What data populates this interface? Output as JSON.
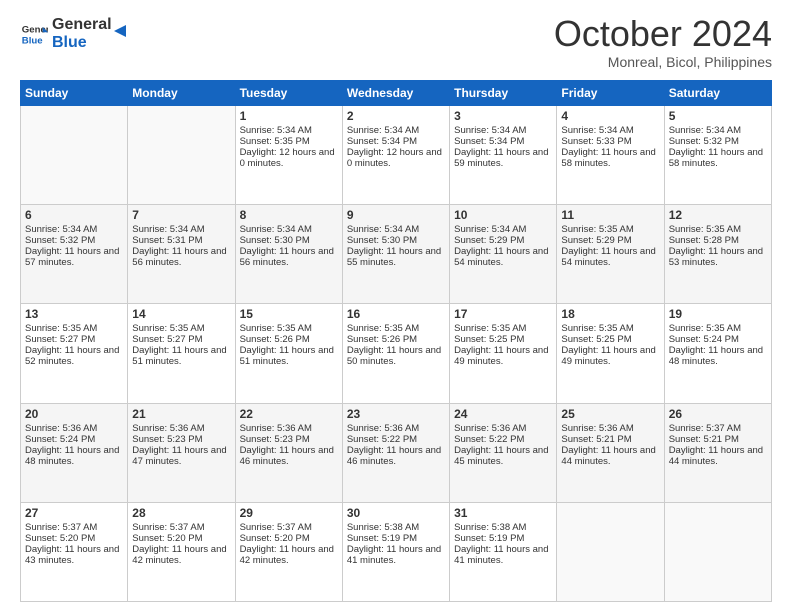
{
  "header": {
    "logo_general": "General",
    "logo_blue": "Blue",
    "month_title": "October 2024",
    "location": "Monreal, Bicol, Philippines"
  },
  "days_of_week": [
    "Sunday",
    "Monday",
    "Tuesday",
    "Wednesday",
    "Thursday",
    "Friday",
    "Saturday"
  ],
  "weeks": [
    [
      {
        "day": "",
        "info": ""
      },
      {
        "day": "",
        "info": ""
      },
      {
        "day": "1",
        "sunrise": "Sunrise: 5:34 AM",
        "sunset": "Sunset: 5:35 PM",
        "daylight": "Daylight: 12 hours and 0 minutes."
      },
      {
        "day": "2",
        "sunrise": "Sunrise: 5:34 AM",
        "sunset": "Sunset: 5:34 PM",
        "daylight": "Daylight: 12 hours and 0 minutes."
      },
      {
        "day": "3",
        "sunrise": "Sunrise: 5:34 AM",
        "sunset": "Sunset: 5:34 PM",
        "daylight": "Daylight: 11 hours and 59 minutes."
      },
      {
        "day": "4",
        "sunrise": "Sunrise: 5:34 AM",
        "sunset": "Sunset: 5:33 PM",
        "daylight": "Daylight: 11 hours and 58 minutes."
      },
      {
        "day": "5",
        "sunrise": "Sunrise: 5:34 AM",
        "sunset": "Sunset: 5:32 PM",
        "daylight": "Daylight: 11 hours and 58 minutes."
      }
    ],
    [
      {
        "day": "6",
        "sunrise": "Sunrise: 5:34 AM",
        "sunset": "Sunset: 5:32 PM",
        "daylight": "Daylight: 11 hours and 57 minutes."
      },
      {
        "day": "7",
        "sunrise": "Sunrise: 5:34 AM",
        "sunset": "Sunset: 5:31 PM",
        "daylight": "Daylight: 11 hours and 56 minutes."
      },
      {
        "day": "8",
        "sunrise": "Sunrise: 5:34 AM",
        "sunset": "Sunset: 5:30 PM",
        "daylight": "Daylight: 11 hours and 56 minutes."
      },
      {
        "day": "9",
        "sunrise": "Sunrise: 5:34 AM",
        "sunset": "Sunset: 5:30 PM",
        "daylight": "Daylight: 11 hours and 55 minutes."
      },
      {
        "day": "10",
        "sunrise": "Sunrise: 5:34 AM",
        "sunset": "Sunset: 5:29 PM",
        "daylight": "Daylight: 11 hours and 54 minutes."
      },
      {
        "day": "11",
        "sunrise": "Sunrise: 5:35 AM",
        "sunset": "Sunset: 5:29 PM",
        "daylight": "Daylight: 11 hours and 54 minutes."
      },
      {
        "day": "12",
        "sunrise": "Sunrise: 5:35 AM",
        "sunset": "Sunset: 5:28 PM",
        "daylight": "Daylight: 11 hours and 53 minutes."
      }
    ],
    [
      {
        "day": "13",
        "sunrise": "Sunrise: 5:35 AM",
        "sunset": "Sunset: 5:27 PM",
        "daylight": "Daylight: 11 hours and 52 minutes."
      },
      {
        "day": "14",
        "sunrise": "Sunrise: 5:35 AM",
        "sunset": "Sunset: 5:27 PM",
        "daylight": "Daylight: 11 hours and 51 minutes."
      },
      {
        "day": "15",
        "sunrise": "Sunrise: 5:35 AM",
        "sunset": "Sunset: 5:26 PM",
        "daylight": "Daylight: 11 hours and 51 minutes."
      },
      {
        "day": "16",
        "sunrise": "Sunrise: 5:35 AM",
        "sunset": "Sunset: 5:26 PM",
        "daylight": "Daylight: 11 hours and 50 minutes."
      },
      {
        "day": "17",
        "sunrise": "Sunrise: 5:35 AM",
        "sunset": "Sunset: 5:25 PM",
        "daylight": "Daylight: 11 hours and 49 minutes."
      },
      {
        "day": "18",
        "sunrise": "Sunrise: 5:35 AM",
        "sunset": "Sunset: 5:25 PM",
        "daylight": "Daylight: 11 hours and 49 minutes."
      },
      {
        "day": "19",
        "sunrise": "Sunrise: 5:35 AM",
        "sunset": "Sunset: 5:24 PM",
        "daylight": "Daylight: 11 hours and 48 minutes."
      }
    ],
    [
      {
        "day": "20",
        "sunrise": "Sunrise: 5:36 AM",
        "sunset": "Sunset: 5:24 PM",
        "daylight": "Daylight: 11 hours and 48 minutes."
      },
      {
        "day": "21",
        "sunrise": "Sunrise: 5:36 AM",
        "sunset": "Sunset: 5:23 PM",
        "daylight": "Daylight: 11 hours and 47 minutes."
      },
      {
        "day": "22",
        "sunrise": "Sunrise: 5:36 AM",
        "sunset": "Sunset: 5:23 PM",
        "daylight": "Daylight: 11 hours and 46 minutes."
      },
      {
        "day": "23",
        "sunrise": "Sunrise: 5:36 AM",
        "sunset": "Sunset: 5:22 PM",
        "daylight": "Daylight: 11 hours and 46 minutes."
      },
      {
        "day": "24",
        "sunrise": "Sunrise: 5:36 AM",
        "sunset": "Sunset: 5:22 PM",
        "daylight": "Daylight: 11 hours and 45 minutes."
      },
      {
        "day": "25",
        "sunrise": "Sunrise: 5:36 AM",
        "sunset": "Sunset: 5:21 PM",
        "daylight": "Daylight: 11 hours and 44 minutes."
      },
      {
        "day": "26",
        "sunrise": "Sunrise: 5:37 AM",
        "sunset": "Sunset: 5:21 PM",
        "daylight": "Daylight: 11 hours and 44 minutes."
      }
    ],
    [
      {
        "day": "27",
        "sunrise": "Sunrise: 5:37 AM",
        "sunset": "Sunset: 5:20 PM",
        "daylight": "Daylight: 11 hours and 43 minutes."
      },
      {
        "day": "28",
        "sunrise": "Sunrise: 5:37 AM",
        "sunset": "Sunset: 5:20 PM",
        "daylight": "Daylight: 11 hours and 42 minutes."
      },
      {
        "day": "29",
        "sunrise": "Sunrise: 5:37 AM",
        "sunset": "Sunset: 5:20 PM",
        "daylight": "Daylight: 11 hours and 42 minutes."
      },
      {
        "day": "30",
        "sunrise": "Sunrise: 5:38 AM",
        "sunset": "Sunset: 5:19 PM",
        "daylight": "Daylight: 11 hours and 41 minutes."
      },
      {
        "day": "31",
        "sunrise": "Sunrise: 5:38 AM",
        "sunset": "Sunset: 5:19 PM",
        "daylight": "Daylight: 11 hours and 41 minutes."
      },
      {
        "day": "",
        "info": ""
      },
      {
        "day": "",
        "info": ""
      }
    ]
  ]
}
